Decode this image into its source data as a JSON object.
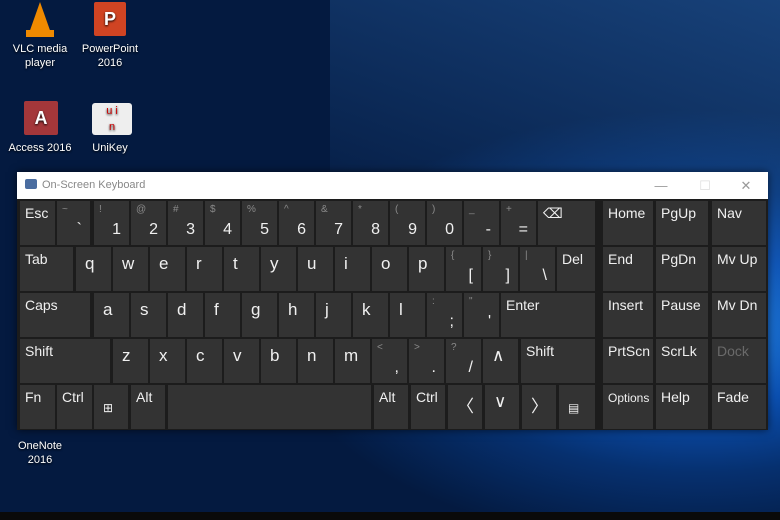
{
  "desktop": {
    "icons": [
      {
        "label": "VLC media player",
        "icon": "vlc-cone-icon"
      },
      {
        "label": "PowerPoint 2016",
        "icon": "powerpoint-icon"
      },
      {
        "label": "Access 2016",
        "icon": "access-icon"
      },
      {
        "label": "UniKey",
        "icon": "unikey-icon"
      },
      {
        "label": "OneNote 2016",
        "icon": "onenote-icon"
      }
    ]
  },
  "window": {
    "title": "On-Screen Keyboard",
    "minimize": "—",
    "maximize": "☐",
    "close": "✕"
  },
  "keyboard": {
    "rows": [
      [
        {
          "m": "Esc",
          "t": "word"
        },
        {
          "m": "`",
          "s": "~",
          "t": "sym"
        },
        {
          "m": "1",
          "s": "!",
          "t": "sym"
        },
        {
          "m": "2",
          "s": "@",
          "t": "sym"
        },
        {
          "m": "3",
          "s": "#",
          "t": "sym"
        },
        {
          "m": "4",
          "s": "$",
          "t": "sym"
        },
        {
          "m": "5",
          "s": "%",
          "t": "sym"
        },
        {
          "m": "6",
          "s": "^",
          "t": "sym"
        },
        {
          "m": "7",
          "s": "&",
          "t": "sym"
        },
        {
          "m": "8",
          "s": "*",
          "t": "sym"
        },
        {
          "m": "9",
          "s": "(",
          "t": "sym"
        },
        {
          "m": "0",
          "s": ")",
          "t": "sym"
        },
        {
          "m": "-",
          "s": "_",
          "t": "sym"
        },
        {
          "m": "=",
          "s": "+",
          "t": "sym"
        },
        {
          "m": "⌫",
          "t": "word",
          "icon": "backspace-icon"
        }
      ],
      [
        {
          "m": "Tab",
          "t": "word"
        },
        {
          "m": "q",
          "t": "letter"
        },
        {
          "m": "w",
          "t": "letter"
        },
        {
          "m": "e",
          "t": "letter"
        },
        {
          "m": "r",
          "t": "letter"
        },
        {
          "m": "t",
          "t": "letter"
        },
        {
          "m": "y",
          "t": "letter"
        },
        {
          "m": "u",
          "t": "letter"
        },
        {
          "m": "i",
          "t": "letter"
        },
        {
          "m": "o",
          "t": "letter"
        },
        {
          "m": "p",
          "t": "letter"
        },
        {
          "m": "[",
          "s": "{",
          "t": "sym"
        },
        {
          "m": "]",
          "s": "}",
          "t": "sym"
        },
        {
          "m": "\\",
          "s": "|",
          "t": "sym"
        },
        {
          "m": "Del",
          "t": "word"
        }
      ],
      [
        {
          "m": "Caps",
          "t": "word"
        },
        {
          "m": "a",
          "t": "letter"
        },
        {
          "m": "s",
          "t": "letter"
        },
        {
          "m": "d",
          "t": "letter"
        },
        {
          "m": "f",
          "t": "letter"
        },
        {
          "m": "g",
          "t": "letter"
        },
        {
          "m": "h",
          "t": "letter"
        },
        {
          "m": "j",
          "t": "letter"
        },
        {
          "m": "k",
          "t": "letter"
        },
        {
          "m": "l",
          "t": "letter"
        },
        {
          "m": ";",
          "s": ":",
          "t": "sym"
        },
        {
          "m": "'",
          "s": "\"",
          "t": "sym"
        },
        {
          "m": "Enter",
          "t": "word"
        }
      ],
      [
        {
          "m": "Shift",
          "t": "word"
        },
        {
          "m": "z",
          "t": "letter"
        },
        {
          "m": "x",
          "t": "letter"
        },
        {
          "m": "c",
          "t": "letter"
        },
        {
          "m": "v",
          "t": "letter"
        },
        {
          "m": "b",
          "t": "letter"
        },
        {
          "m": "n",
          "t": "letter"
        },
        {
          "m": "m",
          "t": "letter"
        },
        {
          "m": ",",
          "s": "<",
          "t": "sym"
        },
        {
          "m": ".",
          "s": ">",
          "t": "sym"
        },
        {
          "m": "/",
          "s": "?",
          "t": "sym"
        },
        {
          "m": "∧",
          "t": "letter",
          "icon": "arrow-up-icon"
        },
        {
          "m": "Shift",
          "t": "word"
        }
      ],
      [
        {
          "m": "Fn",
          "t": "word"
        },
        {
          "m": "Ctrl",
          "t": "word"
        },
        {
          "m": "⊞",
          "t": "letter",
          "icon": "windows-icon"
        },
        {
          "m": "Alt",
          "t": "word"
        },
        {
          "m": "",
          "t": "word",
          "icon": "space"
        },
        {
          "m": "Alt",
          "t": "word"
        },
        {
          "m": "Ctrl",
          "t": "word"
        },
        {
          "m": "〈",
          "t": "letter",
          "icon": "arrow-left-icon"
        },
        {
          "m": "∨",
          "t": "letter",
          "icon": "arrow-down-icon"
        },
        {
          "m": "〉",
          "t": "letter",
          "icon": "arrow-right-icon"
        },
        {
          "m": "▤",
          "t": "letter",
          "icon": "menu-icon"
        }
      ]
    ],
    "nav": [
      [
        {
          "m": "Home"
        },
        {
          "m": "PgUp"
        },
        {
          "m": "Nav"
        }
      ],
      [
        {
          "m": "End"
        },
        {
          "m": "PgDn"
        },
        {
          "m": "Mv Up"
        }
      ],
      [
        {
          "m": "Insert"
        },
        {
          "m": "Pause"
        },
        {
          "m": "Mv Dn"
        }
      ],
      [
        {
          "m": "PrtScn"
        },
        {
          "m": "ScrLk"
        },
        {
          "m": "Dock",
          "disabled": true
        }
      ],
      [
        {
          "m": "Options",
          "small": true
        },
        {
          "m": "Help"
        },
        {
          "m": "Fade"
        }
      ]
    ]
  }
}
